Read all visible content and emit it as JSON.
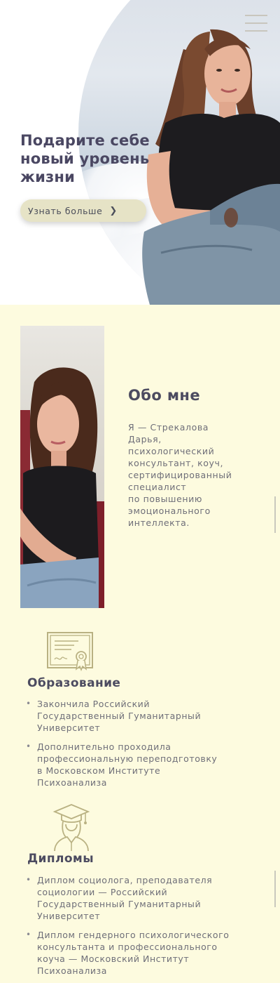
{
  "hero": {
    "title": "Подарите себе\nновый уровень\nжизни",
    "button_label": "Узнать больше",
    "button_icon": "chevron-right-icon",
    "menu_icon": "hamburger-menu-icon"
  },
  "about": {
    "title": "Обо мне",
    "text": "Я — Стрекалова\nДарья,\nпсихологический\nконсультант, коуч,\nсертифицированный\nспециалист\nпо повышению\nэмоционального\nинтеллекта."
  },
  "education": {
    "icon": "certificate-icon",
    "title": "Образование",
    "items": [
      "Закончила Российский\nГосударственный Гуманитарный\nУниверситет",
      "Дополнительно проходила\nпрофессиональную переподготовку\nв Московском Институте\nПсихоанализа"
    ]
  },
  "diplomas": {
    "icon": "graduate-icon",
    "title": "Дипломы",
    "items": [
      "Диплом социолога, преподавателя\nсоциологии — Российский\nГосударственный Гуманитарный\nУниверситет",
      "Диплом гендерного психологического\nконсультанта и профессионального\nкоуча — Московский Институт\nПсихоанализа"
    ]
  },
  "colors": {
    "page_background": "#fdfbdf",
    "heading": "#4c4b60",
    "body_text": "#6e6e78",
    "icon_stroke": "#b9b182",
    "button_background": "#e6e3c6"
  }
}
